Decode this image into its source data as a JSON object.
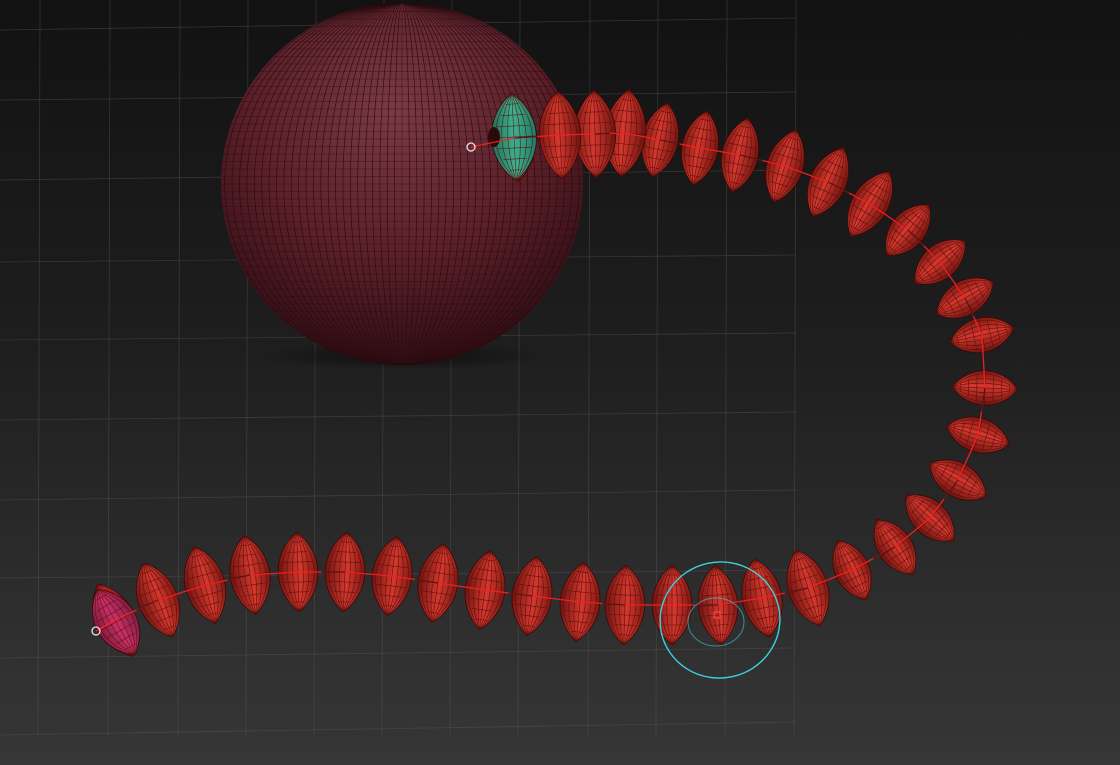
{
  "viewport": {
    "background_top": "#121212",
    "background_bottom": "#363636",
    "grid_color": "#5a5a5a"
  },
  "sphere": {
    "color": "#5a1f29",
    "highlight": "#7a3a46",
    "wire_color": "#2a0c10"
  },
  "chain": {
    "segment_color": "#c0302a",
    "segment_dark": "#6e1410",
    "segment_wire": "#5a0e0a",
    "selected_start_color": "#2e9a80",
    "end_color": "#b02858",
    "spine_color": "#ff2020",
    "segment_count": 38
  },
  "gizmo": {
    "ring_color": "#3fd0e0",
    "pivot_color": "#ff4040",
    "endpoint_marker_color": "#e8e8e8"
  }
}
